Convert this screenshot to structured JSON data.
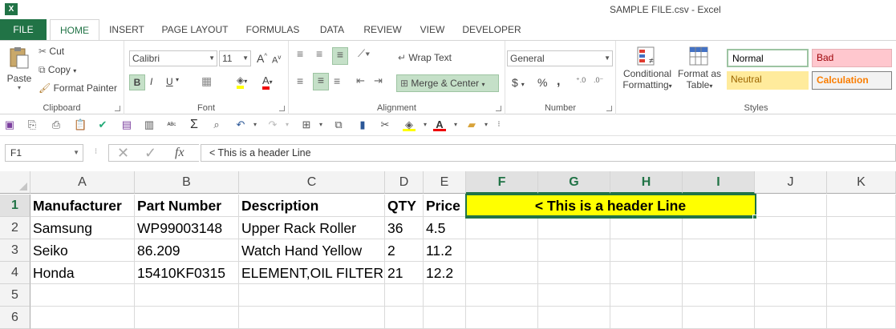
{
  "window": {
    "title": "SAMPLE FILE.csv - Excel",
    "logo": "X"
  },
  "tabs": [
    "FILE",
    "HOME",
    "INSERT",
    "PAGE LAYOUT",
    "FORMULAS",
    "DATA",
    "REVIEW",
    "VIEW",
    "DEVELOPER"
  ],
  "ribbon": {
    "clipboard": {
      "paste": "Paste",
      "cut": "Cut",
      "copy": "Copy",
      "format_painter": "Format Painter",
      "label": "Clipboard"
    },
    "font": {
      "name": "Calibri",
      "size": "11",
      "label": "Font",
      "bold": "B",
      "italic": "I",
      "underline": "U",
      "grow": "A",
      "shrink": "A",
      "font_color": "A"
    },
    "alignment": {
      "wrap_text": "Wrap Text",
      "merge_center": "Merge & Center",
      "label": "Alignment"
    },
    "number": {
      "format": "General",
      "currency": "$",
      "percent": "%",
      "comma": ",",
      "label": "Number"
    },
    "styles": {
      "conditional": "Conditional",
      "formatting": "Formatting",
      "format_as": "Format as",
      "table": "Table",
      "normal": "Normal",
      "bad": "Bad",
      "neutral": "Neutral",
      "calculation": "Calculation",
      "label": "Styles"
    }
  },
  "formula_bar": {
    "name_box": "F1",
    "fx": "fx",
    "formula": "< This is a header Line"
  },
  "columns": [
    "A",
    "B",
    "C",
    "D",
    "E",
    "F",
    "G",
    "H",
    "I",
    "J",
    "K"
  ],
  "rows": [
    "1",
    "2",
    "3",
    "4",
    "5",
    "6"
  ],
  "cells": {
    "header": [
      "Manufacturer",
      "Part Number",
      "Description",
      "QTY",
      "Price"
    ],
    "data": [
      [
        "Samsung",
        "WP99003148",
        "Upper Rack Roller",
        "36",
        "4.5"
      ],
      [
        "Seiko",
        "86.209",
        "Watch Hand Yellow",
        "2",
        "11.2"
      ],
      [
        "Honda",
        "15410KF0315",
        "ELEMENT,OIL FILTER",
        "21",
        "12.2"
      ]
    ],
    "merged_f1_i1": "< This is a header Line"
  },
  "colors": {
    "accent": "#217346",
    "merged_fill": "#ffff00",
    "bad_fill": "#ffc7ce",
    "neutral_fill": "#ffeb9c",
    "calc_text": "#fa7d00"
  }
}
